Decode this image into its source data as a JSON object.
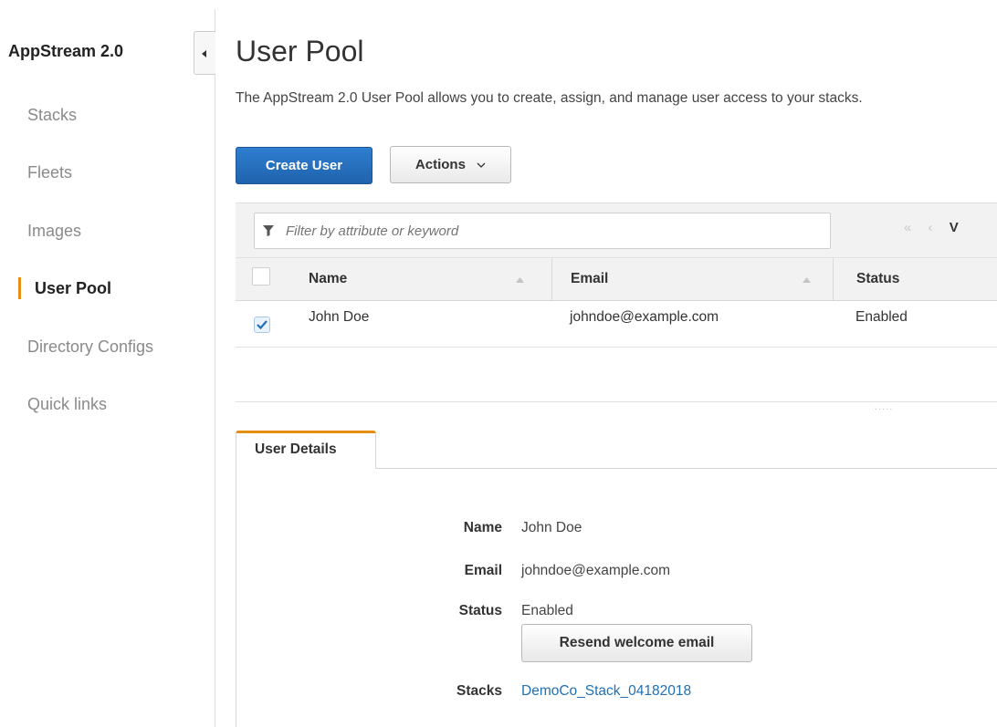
{
  "sidebar": {
    "app_title": "AppStream 2.0",
    "items": [
      {
        "label": "Stacks"
      },
      {
        "label": "Fleets"
      },
      {
        "label": "Images"
      },
      {
        "label": "User Pool",
        "active": true
      },
      {
        "label": "Directory Configs"
      },
      {
        "label": "Quick links"
      }
    ],
    "active_color": "#e68e14"
  },
  "header": {
    "title": "User Pool",
    "description": "The AppStream 2.0 User Pool allows you to create, assign, and manage user access to your stacks."
  },
  "toolbar": {
    "create_label": "Create User",
    "actions_label": "Actions",
    "primary_color": "#2a74c4"
  },
  "filter": {
    "placeholder": "Filter by attribute or keyword",
    "pager_first": "«",
    "pager_prev": "‹",
    "pager_view_fragment": "V"
  },
  "table": {
    "columns": [
      {
        "label": "Name",
        "sortable": true
      },
      {
        "label": "Email",
        "sortable": true
      },
      {
        "label": "Status"
      }
    ],
    "rows": [
      {
        "selected": true,
        "name": "John Doe",
        "email": "johndoe@example.com",
        "status": "Enabled"
      }
    ]
  },
  "divider": {
    "grip": "....."
  },
  "details": {
    "tab_label": "User Details",
    "fields": {
      "name_label": "Name",
      "name_value": "John Doe",
      "email_label": "Email",
      "email_value": "johndoe@example.com",
      "status_label": "Status",
      "status_value": "Enabled",
      "stacks_label": "Stacks",
      "stacks_value": "DemoCo_Stack_04182018"
    },
    "resend_label": "Resend welcome email",
    "link_color": "#1f6fb5"
  }
}
